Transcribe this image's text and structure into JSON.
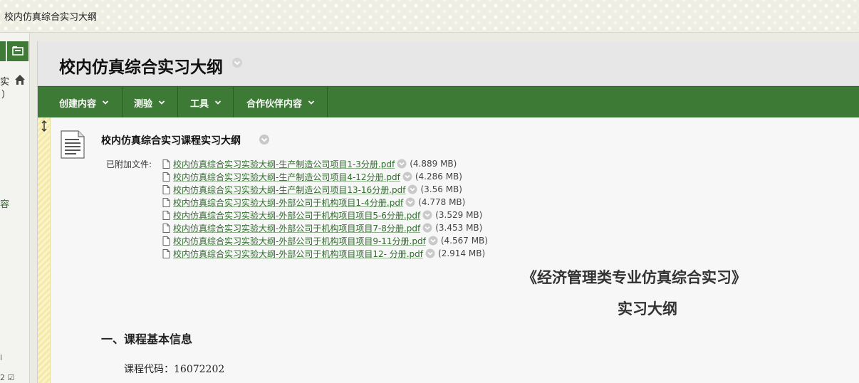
{
  "banner": {
    "title": "校内仿真综合实习大纲"
  },
  "sidebar": {
    "text_1": "实",
    "text_2": "）",
    "text_3": "容",
    "bottom_1": "l",
    "bottom_2": "2 ☑"
  },
  "header": {
    "title": "校内仿真综合实习大纲"
  },
  "action_bar": {
    "items": [
      {
        "label": "创建内容"
      },
      {
        "label": "测验"
      },
      {
        "label": "工具"
      },
      {
        "label": "合作伙伴内容"
      }
    ]
  },
  "content_item": {
    "title": "校内仿真综合实习课程实习大纲",
    "attached_label": "已附加文件:",
    "files": [
      {
        "name": "校内仿真综合实习实验大纲-生产制造公司项目1-3分册.pdf",
        "size": "(4.889 MB)"
      },
      {
        "name": "校内仿真综合实习实验大纲-生产制造公司项目4-12分册.pdf",
        "size": "(4.286 MB)"
      },
      {
        "name": "校内仿真综合实习实验大纲-生产制造公司项目13-16分册.pdf",
        "size": "(3.56 MB)"
      },
      {
        "name": "校内仿真综合实习实验大纲-外部公司于机构项目1-4分册.pdf",
        "size": "(4.778 MB)"
      },
      {
        "name": "校内仿真综合实习实验大纲-外部公司于机构项目项目5-6分册.pdf",
        "size": "(3.529 MB)"
      },
      {
        "name": "校内仿真综合实习实验大纲-外部公司于机构项目项目7-8分册.pdf",
        "size": "(3.453 MB)"
      },
      {
        "name": "校内仿真综合实习实验大纲-外部公司于机构项目项目9-11分册.pdf",
        "size": "(4.567 MB)"
      },
      {
        "name": "校内仿真综合实习实验大纲-外部公司于机构项目项目12- 分册.pdf",
        "size": "(2.914 MB)"
      }
    ],
    "outline_title": "《经济管理类专业仿真综合实习》",
    "outline_subtitle": "实习大纲",
    "section_heading": "一、课程基本信息",
    "course_code": "课程代码：16072202"
  },
  "colors": {
    "action_bar": "#3d7a35",
    "link": "#2f6b2c",
    "drag_rail": "#f5e9a8"
  },
  "icons": [
    "folder-icon",
    "home-icon",
    "chevron-down-icon",
    "drag-handle-icon",
    "document-icon",
    "file-icon"
  ]
}
